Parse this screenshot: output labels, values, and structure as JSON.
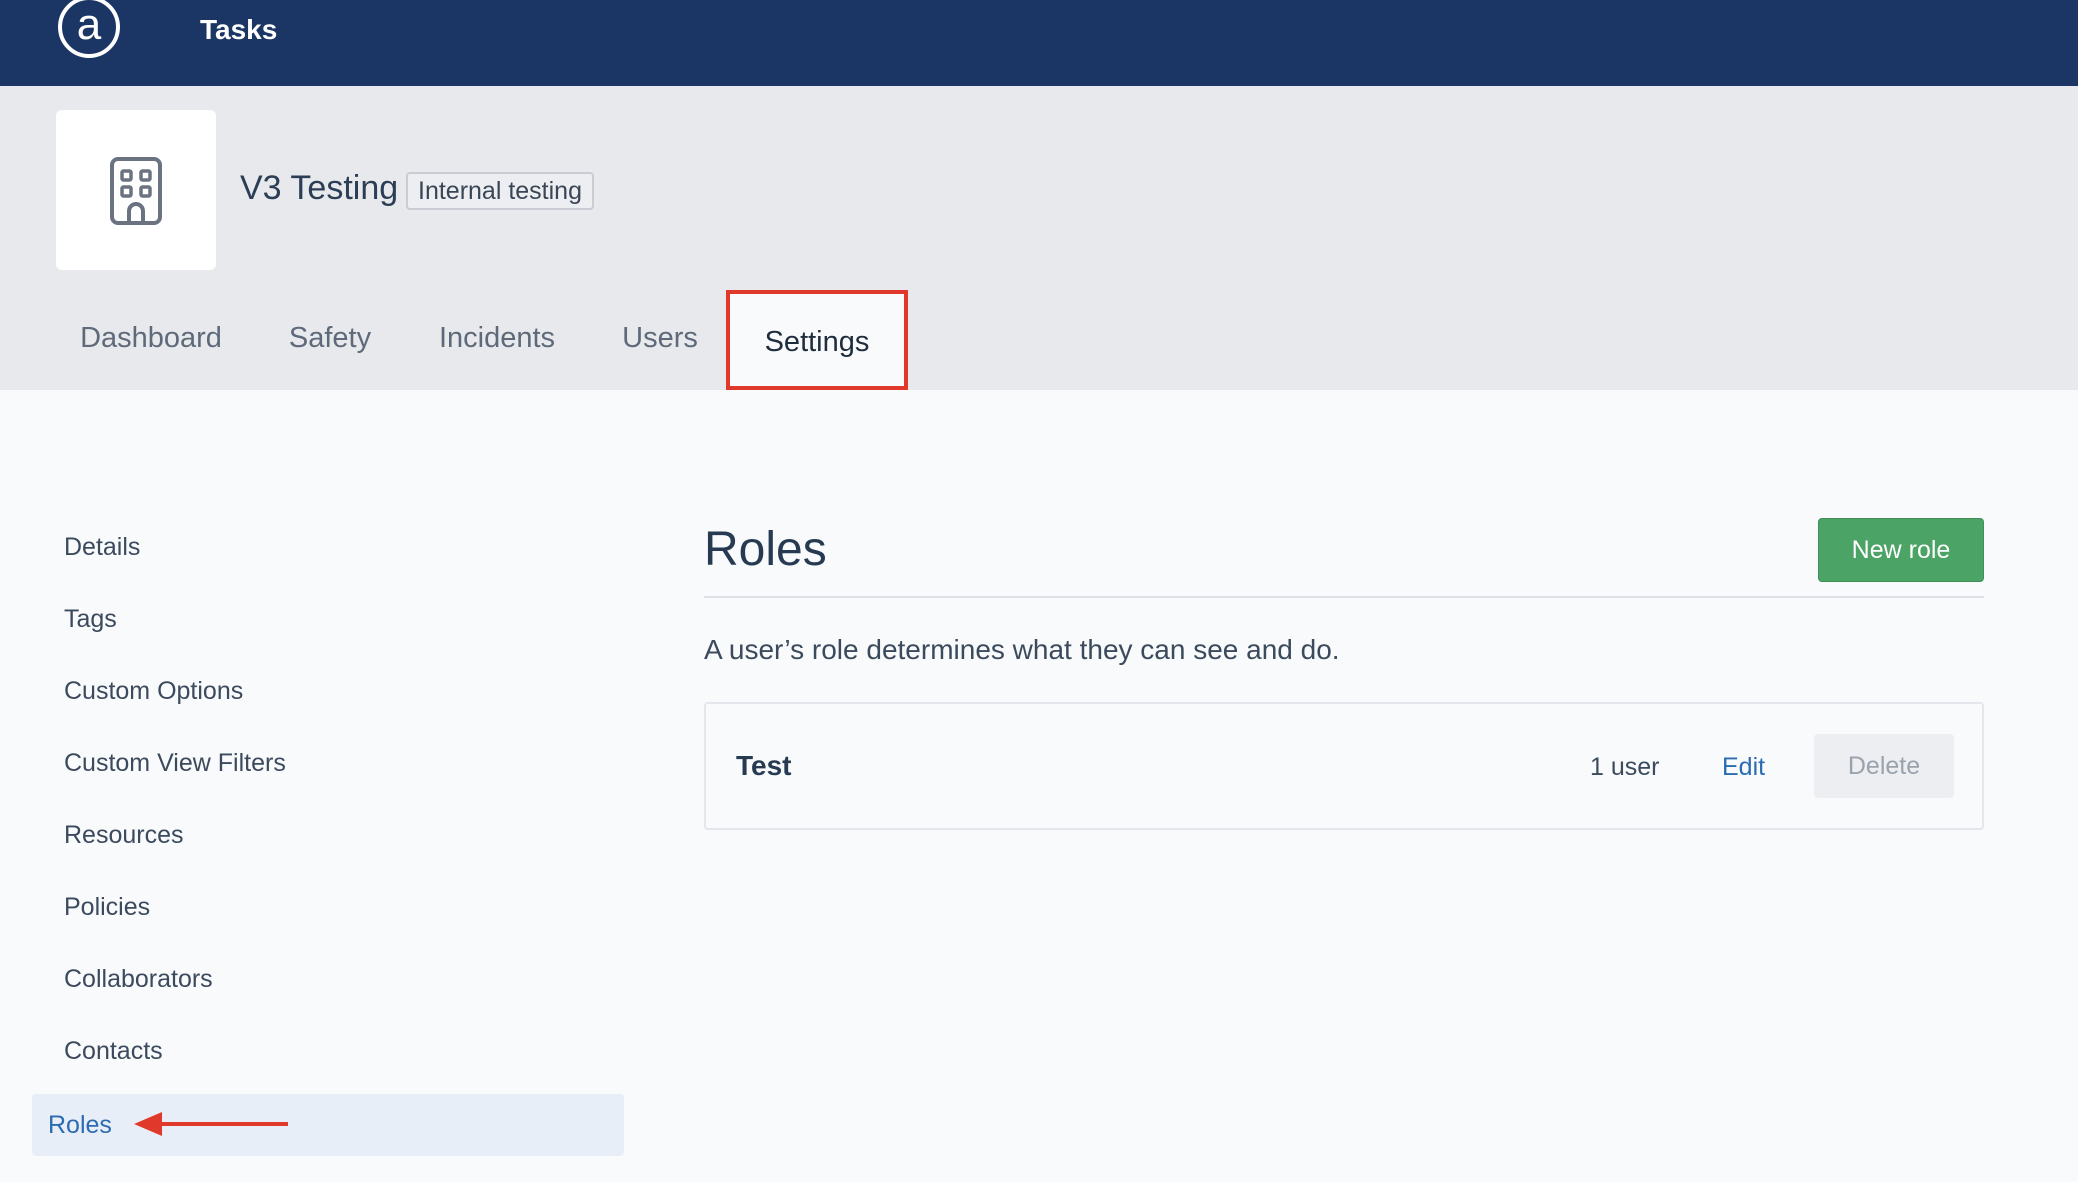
{
  "app": {
    "logo_glyph": "a",
    "title": "Tasks"
  },
  "project": {
    "name": "V3 Testing",
    "badge": "Internal testing",
    "avatar_icon": "building-icon"
  },
  "tabs": [
    {
      "label": "Dashboard",
      "active": false
    },
    {
      "label": "Safety",
      "active": false
    },
    {
      "label": "Incidents",
      "active": false
    },
    {
      "label": "Users",
      "active": false
    },
    {
      "label": "Settings",
      "active": true
    }
  ],
  "sidebar": {
    "items": [
      {
        "label": "Details"
      },
      {
        "label": "Tags"
      },
      {
        "label": "Custom Options"
      },
      {
        "label": "Custom View Filters"
      },
      {
        "label": "Resources"
      },
      {
        "label": "Policies"
      },
      {
        "label": "Collaborators"
      },
      {
        "label": "Contacts"
      },
      {
        "label": "Roles",
        "active": true
      }
    ]
  },
  "main": {
    "title": "Roles",
    "new_button": "New role",
    "description": "A user’s role determines what they can see and do.",
    "roles": [
      {
        "name": "Test",
        "count": "1 user",
        "edit": "Edit",
        "delete": "Delete"
      }
    ]
  },
  "colors": {
    "navbar": "#1b3564",
    "accent_green": "#4ba365",
    "link_blue": "#2b6cb0",
    "annotation_red": "#e0392b"
  }
}
